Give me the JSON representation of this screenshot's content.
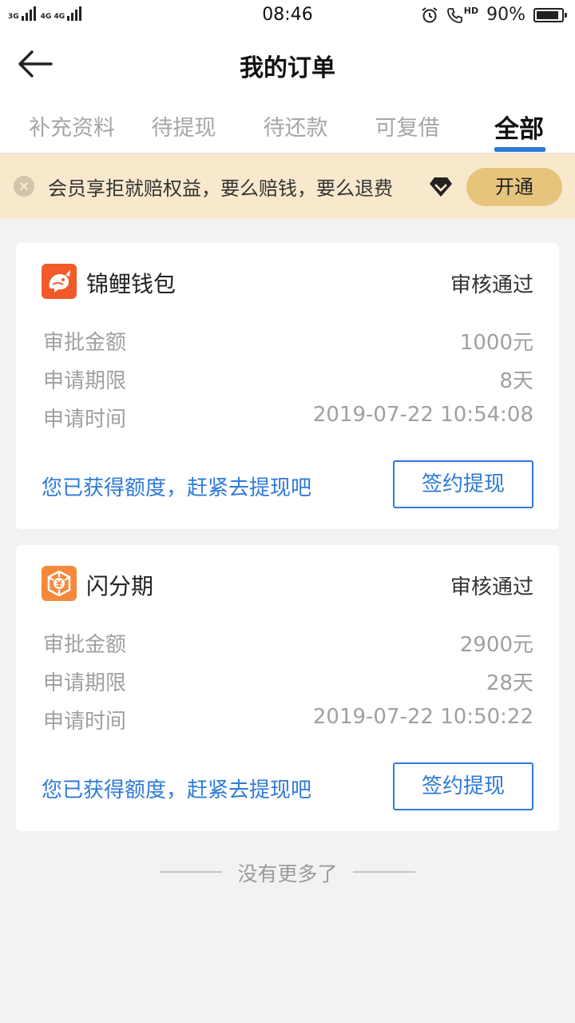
{
  "status_bar": {
    "signal1_label": "3G",
    "signal2_label": "4G 4G",
    "time": "08:46",
    "hd_label": "HD",
    "battery": "90%",
    "battery_level": 0.9
  },
  "header": {
    "title": "我的订单"
  },
  "tabs": [
    {
      "label": "补充资料"
    },
    {
      "label": "待提现"
    },
    {
      "label": "待还款"
    },
    {
      "label": "可复借"
    },
    {
      "label": "全部"
    }
  ],
  "active_tab": "全部",
  "banner": {
    "text": "会员享拒就赔权益，要么赔钱，要么退费",
    "button": "开通"
  },
  "orders": [
    {
      "lender": "锦鲤钱包",
      "status": "审核通过",
      "amount_label": "审批金额",
      "amount": "1000元",
      "term_label": "申请期限",
      "term": "8天",
      "time_label": "申请时间",
      "time": "2019-07-22 10:54:08",
      "hint": "您已获得额度，赶紧去提现吧",
      "button": "签约提现"
    },
    {
      "lender": "闪分期",
      "status": "审核通过",
      "amount_label": "审批金额",
      "amount": "2900元",
      "term_label": "申请期限",
      "term": "28天",
      "time_label": "申请时间",
      "time": "2019-07-22 10:50:22",
      "hint": "您已获得额度，赶紧去提现吧",
      "button": "签约提现"
    }
  ],
  "footer": {
    "no_more": "没有更多了"
  },
  "colors": {
    "accent": "#2f7ad8",
    "banner_bg": "#f8e9cd",
    "banner_button": "#e6c47c",
    "logo1": "#f25a2a",
    "logo2": "#f5883a"
  }
}
